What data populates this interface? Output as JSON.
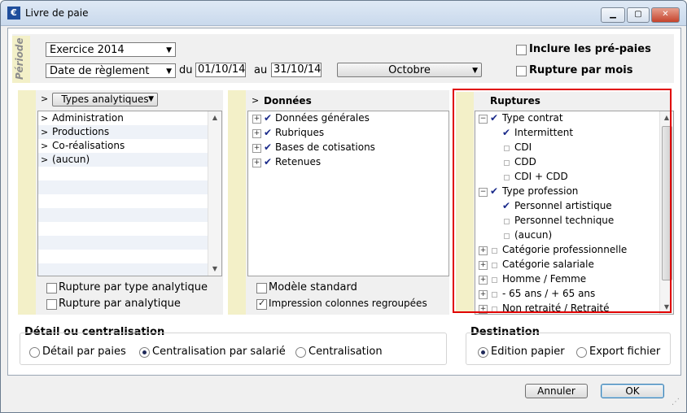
{
  "window": {
    "title": "Livre de paie"
  },
  "periode": {
    "label": "Période",
    "exercice": "Exercice 2014",
    "date_type": "Date de règlement",
    "du_label": "du",
    "du": "01/10/14",
    "au_label": "au",
    "au": "31/10/14",
    "month": "Octobre",
    "inclure_prepaies": "Inclure les pré-paies",
    "rupture_mois": "Rupture par mois"
  },
  "analytique": {
    "header_select": "Types analytiques",
    "items": [
      "Administration",
      "Productions",
      "Co-réalisations",
      "(aucun)"
    ],
    "rupture_type": "Rupture par type analytique",
    "rupture_analytique": "Rupture par analytique"
  },
  "donnees": {
    "header": "Données",
    "items": [
      "Données générales",
      "Rubriques",
      "Bases de cotisations",
      "Retenues"
    ],
    "modele_standard": "Modèle standard",
    "impression_colonnes": "Impression colonnes regroupées"
  },
  "ruptures": {
    "header": "Ruptures",
    "items": [
      {
        "label": "Type contrat",
        "level": 0,
        "checked": true,
        "expanded": true
      },
      {
        "label": "Intermittent",
        "level": 1,
        "checked": true
      },
      {
        "label": "CDI",
        "level": 1,
        "checked": false
      },
      {
        "label": "CDD",
        "level": 1,
        "checked": false
      },
      {
        "label": "CDI + CDD",
        "level": 1,
        "checked": false
      },
      {
        "label": "Type profession",
        "level": 0,
        "checked": true,
        "expanded": true
      },
      {
        "label": "Personnel artistique",
        "level": 1,
        "checked": true
      },
      {
        "label": "Personnel technique",
        "level": 1,
        "checked": false
      },
      {
        "label": "(aucun)",
        "level": 1,
        "checked": false
      },
      {
        "label": "Catégorie professionnelle",
        "level": 0,
        "checked": false,
        "expanded": false
      },
      {
        "label": "Catégorie salariale",
        "level": 0,
        "checked": false,
        "expanded": false
      },
      {
        "label": "Homme / Femme",
        "level": 0,
        "checked": false,
        "expanded": false
      },
      {
        "label": "- 65 ans / + 65 ans",
        "level": 0,
        "checked": false,
        "expanded": false
      },
      {
        "label": "Non retraité / Retraité",
        "level": 0,
        "checked": false,
        "expanded": false
      }
    ]
  },
  "detail": {
    "title": "Détail ou centralisation",
    "options": [
      "Détail par paies",
      "Centralisation par salarié",
      "Centralisation"
    ],
    "selected": 1
  },
  "destination": {
    "title": "Destination",
    "options": [
      "Edition papier",
      "Export fichier"
    ],
    "selected": 0
  },
  "buttons": {
    "cancel": "Annuler",
    "ok": "OK"
  },
  "colors": {
    "highlight_border": "#e00000",
    "panel_accent": "#f3f0c8",
    "check": "#1a2a8a"
  }
}
